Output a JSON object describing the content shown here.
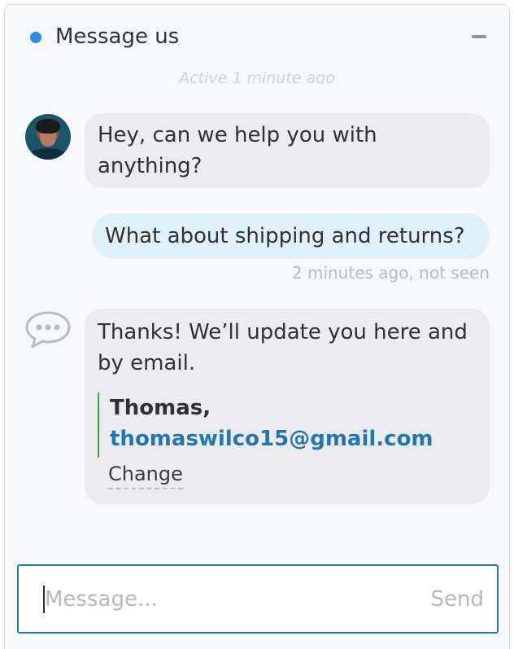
{
  "header": {
    "title": "Message us",
    "status_color": "#2a8ee8",
    "minimize_icon": "minus-icon"
  },
  "conversation": {
    "active_status": "Active 1 minute ago",
    "messages": [
      {
        "sender": "agent",
        "avatar_icon": "agent-avatar",
        "text": "Hey, can we help you with anything?"
      },
      {
        "sender": "user",
        "text": "What about shipping and returns?",
        "meta": "2 minutes ago, not seen"
      },
      {
        "sender": "system",
        "avatar_icon": "chat-bubble-icon",
        "text": "Thanks! We’ll update you here and by email.",
        "contact": {
          "name": "Thomas,",
          "email": "thomaswilco15@gmail.com",
          "change_label": "Change"
        }
      }
    ]
  },
  "composer": {
    "placeholder": "Message...",
    "value": "",
    "send_label": "Send",
    "accent_color": "#2276b3"
  }
}
